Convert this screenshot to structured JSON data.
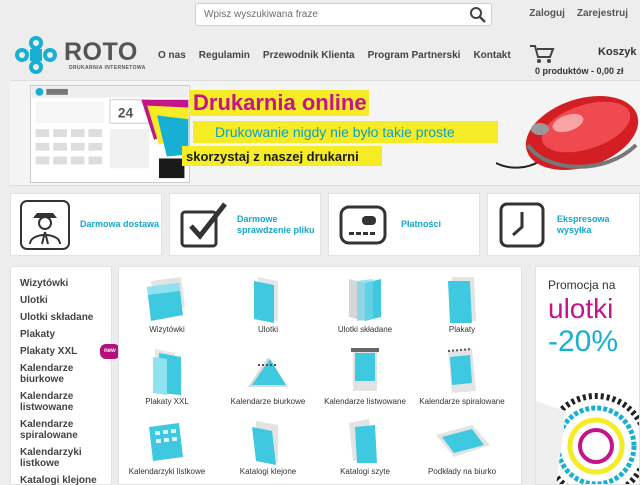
{
  "search": {
    "placeholder": "Wpisz wyszukiwana fraze"
  },
  "account": {
    "login": "Zaloguj",
    "register": "Zarejestruj"
  },
  "brand": {
    "name": "ROTO",
    "tagline": "DRUKARNIA INTERNETOWA",
    "color": "#18b0d2"
  },
  "nav": {
    "items": [
      "O nas",
      "Regulamin",
      "Przewodnik Klienta",
      "Program Partnerski",
      "Kontakt"
    ]
  },
  "cart": {
    "title": "Koszyk",
    "summary": "0 produktów - 0,00 zł"
  },
  "banner": {
    "headline": "Drukarnia online",
    "line2": "Drukowanie nigdy nie było takie proste",
    "line3": "skorzystaj z naszej drukarni",
    "screen_hours": "24"
  },
  "features": [
    {
      "label": "Darmowa dostawa",
      "icon": "courier-icon"
    },
    {
      "label": "Darmowe sprawdzenie pliku",
      "icon": "checkmark-icon"
    },
    {
      "label": "Płatności",
      "icon": "card-icon"
    },
    {
      "label": "Ekspresowa wysyłka",
      "icon": "clock-icon"
    }
  ],
  "sidebar": {
    "items": [
      "Wizytówki",
      "Ulotki",
      "Ulotki składane",
      "Plakaty",
      "Plakaty XXL",
      "Kalendarze biurkowe",
      "Kalendarze listwowane",
      "Kalendarze spiralowane",
      "Kalendarzyki listkowe",
      "Katalogi klejone"
    ],
    "badge": "new"
  },
  "products": [
    "Wizytówki",
    "Ulotki",
    "Ulotki składane",
    "Plakaty",
    "Plakaty XXL",
    "Kalendarze biurkowe",
    "Kalendarze listwowane",
    "Kalendarze spiralowane",
    "Kalendarzyki listkowe",
    "Katalogi klejone",
    "Katalogi szyte",
    "Podkłady na biurko"
  ],
  "promo": {
    "line1": "Promocja na",
    "line2": "ulotki",
    "line3": "-20%"
  },
  "colors": {
    "accent": "#18b0d2",
    "magenta": "#c4148a",
    "yellow": "#f5ec25"
  }
}
